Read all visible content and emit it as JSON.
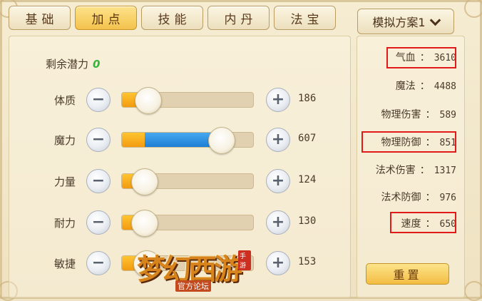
{
  "tabs": [
    {
      "label": "基础",
      "active": false
    },
    {
      "label": "加点",
      "active": true
    },
    {
      "label": "技能",
      "active": false
    },
    {
      "label": "内丹",
      "active": false
    },
    {
      "label": "法宝",
      "active": false
    }
  ],
  "plan_select": {
    "label": "模拟方案1"
  },
  "potential": {
    "label": "剩余潜力",
    "value": "0"
  },
  "attributes": [
    {
      "label": "体质",
      "value": "186",
      "level": 0.2,
      "fill_color": "orange"
    },
    {
      "label": "魔力",
      "value": "607",
      "level": 0.75,
      "fill_color": "blue"
    },
    {
      "label": "力量",
      "value": "124",
      "level": 0.17,
      "fill_color": "orange"
    },
    {
      "label": "耐力",
      "value": "130",
      "level": 0.17,
      "fill_color": "orange"
    },
    {
      "label": "敏捷",
      "value": "153",
      "level": 0.19,
      "fill_color": "orange"
    }
  ],
  "stats": [
    {
      "label": "气血",
      "value": "3610",
      "highlighted": true
    },
    {
      "label": "魔法",
      "value": "4488",
      "highlighted": false
    },
    {
      "label": "物理伤害",
      "value": "589",
      "highlighted": false
    },
    {
      "label": "物理防御",
      "value": "851",
      "highlighted": true
    },
    {
      "label": "法术伤害",
      "value": "1317",
      "highlighted": false
    },
    {
      "label": "法术防御",
      "value": "976",
      "highlighted": false
    },
    {
      "label": "速度",
      "value": "650",
      "highlighted": true
    }
  ],
  "stat_separator": "：",
  "reset_button": {
    "label": "重置"
  },
  "buttons": {
    "minus": "−",
    "plus": "+"
  },
  "watermark": {
    "main": "梦幻西游",
    "sub": "官方论坛",
    "badge": "手游"
  },
  "colors": {
    "highlight": "#e11a1a",
    "active_tab": "#f4c24d",
    "potential_value": "#35b43a",
    "mana_fill": "#1f7fd6",
    "fill_default": "#f29b10"
  }
}
